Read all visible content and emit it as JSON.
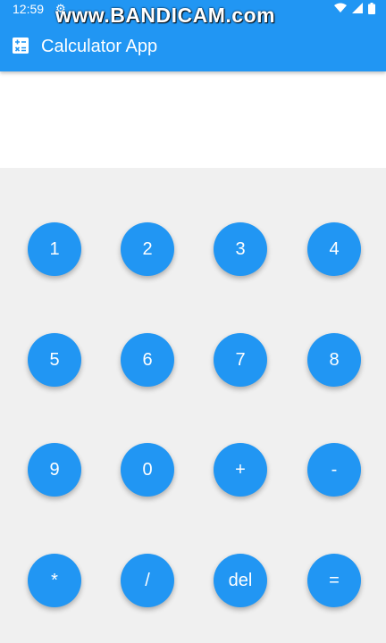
{
  "status_bar": {
    "time": "12:59",
    "watermark": "www.BANDICAM.com"
  },
  "app_bar": {
    "title": "Calculator App",
    "icon": "calculator-icon"
  },
  "display": {
    "value": ""
  },
  "keys": [
    {
      "label": "1"
    },
    {
      "label": "2"
    },
    {
      "label": "3"
    },
    {
      "label": "4"
    },
    {
      "label": "5"
    },
    {
      "label": "6"
    },
    {
      "label": "7"
    },
    {
      "label": "8"
    },
    {
      "label": "9"
    },
    {
      "label": "0"
    },
    {
      "label": "+"
    },
    {
      "label": "-"
    },
    {
      "label": "*"
    },
    {
      "label": "/"
    },
    {
      "label": "del"
    },
    {
      "label": "="
    }
  ],
  "colors": {
    "primary": "#2196F3",
    "keypad_background": "#f0f0f0",
    "display_background": "#ffffff"
  }
}
